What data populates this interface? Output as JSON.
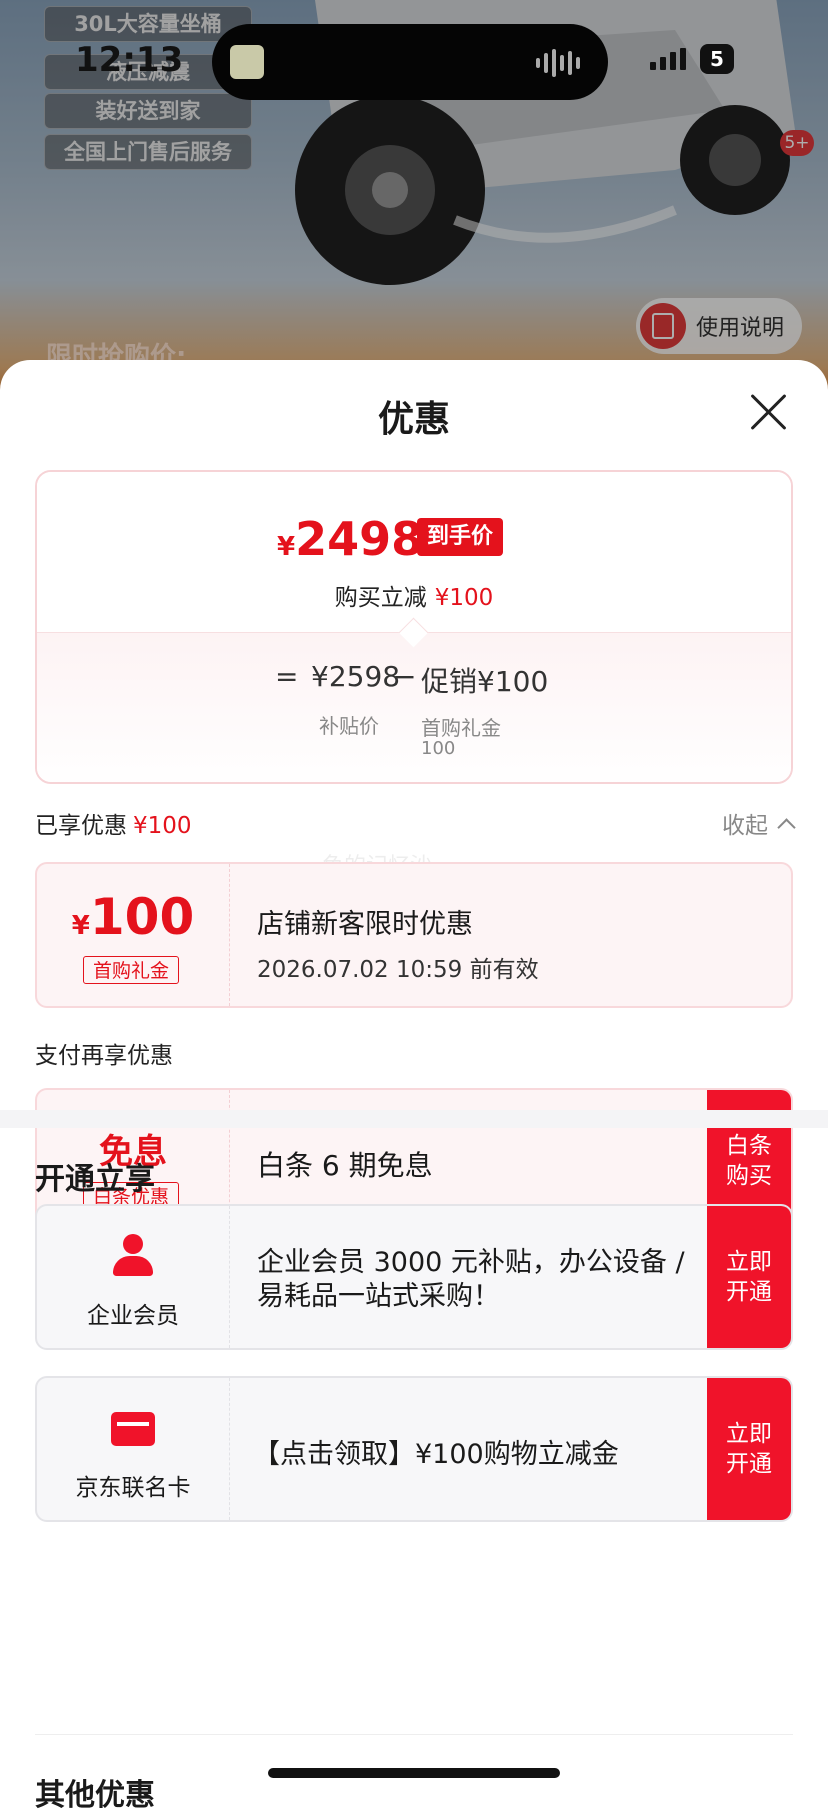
{
  "status_bar": {
    "time": "12:13",
    "battery": "5"
  },
  "background": {
    "features": [
      "30L大容量坐桶",
      "液压减震",
      "装好送到家",
      "全国上门售后服务"
    ],
    "promo_label": "限时抢购价:",
    "manual_button": "使用说明",
    "cart_badge": "5+"
  },
  "sheet": {
    "title": "优惠",
    "summary": {
      "currency": "¥",
      "final_price": "2498",
      "final_tag": "到手价",
      "reduce_label": "购买立减",
      "reduce_value": "¥100",
      "eq": "=",
      "subsidy_value": "¥2598",
      "subsidy_label": "补贴价",
      "minus": "−",
      "promo_value": "促销¥100",
      "promo_label": "首购礼金",
      "promo_sub": "100"
    },
    "enjoyed": {
      "label": "已享优惠",
      "value": "¥100",
      "collapse": "收起"
    },
    "watermark": "鱼的记忆沙",
    "coupon1": {
      "currency": "¥",
      "amount": "100",
      "tag": "首购礼金",
      "title": "店铺新客限时优惠",
      "expire": "2026.07.02 10:59 前有效"
    },
    "pay_more": {
      "label": "支付再享优惠"
    },
    "coupon2": {
      "big": "免息",
      "tag": "白条优惠",
      "title": "白条 6 期免息",
      "button": "白条购买"
    },
    "open_now": {
      "title": "开通立享"
    },
    "member1": {
      "name": "企业会员",
      "desc": "企业会员 3000 元补贴，办公设备 / 易耗品一站式采购！",
      "button": "立即开通"
    },
    "member2": {
      "name": "京东联名卡",
      "desc": "【点击领取】¥100购物立减金",
      "button": "立即开通"
    },
    "other": {
      "title": "其他优惠"
    }
  },
  "colors": {
    "accent": "#e4121c",
    "button_red": "#f0132a"
  }
}
